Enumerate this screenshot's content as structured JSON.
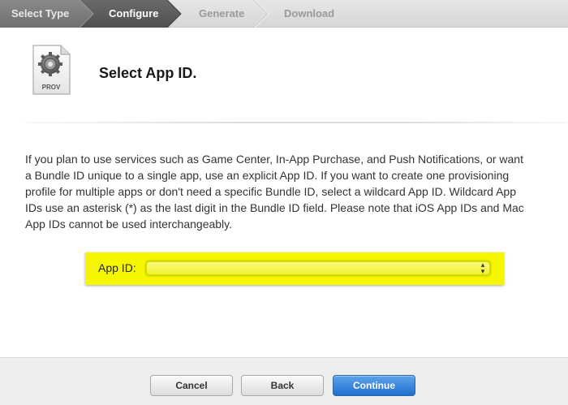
{
  "steps": [
    {
      "label": "Select Type",
      "state": "done"
    },
    {
      "label": "Configure",
      "state": "current"
    },
    {
      "label": "Generate",
      "state": "future"
    },
    {
      "label": "Download",
      "state": "future"
    }
  ],
  "header": {
    "icon_label": "PROV",
    "title": "Select App ID."
  },
  "description": "If you plan to use services such as Game Center, In-App Purchase, and Push Notifications, or want a Bundle ID unique to a single app, use an explicit App ID. If you want to create one provisioning profile for multiple apps or don't need a specific Bundle ID, select a wildcard App ID. Wildcard App IDs use an asterisk (*) as the last digit in the Bundle ID field. Please note that iOS App IDs and Mac App IDs cannot be used interchangeably.",
  "form": {
    "app_id_label": "App ID:",
    "app_id_value": ""
  },
  "footer": {
    "cancel_label": "Cancel",
    "back_label": "Back",
    "continue_label": "Continue"
  },
  "colors": {
    "highlight": "#f6f600",
    "primary_button": "#1f6fcf",
    "step_done": "#7a7a7a",
    "step_current": "#555555",
    "step_future": "#dddddd"
  }
}
